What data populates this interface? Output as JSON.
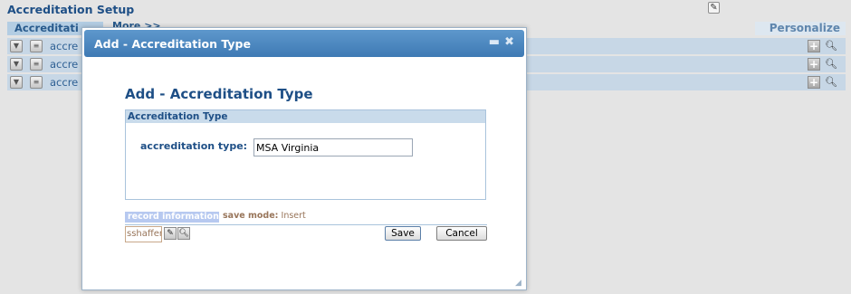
{
  "page": {
    "title": "Accreditation Setup"
  },
  "grid": {
    "tab_label": "Accreditati",
    "more_label": "More >>",
    "personalize_label": "Personalize",
    "rows": [
      {
        "text": "accre"
      },
      {
        "text": "accre"
      },
      {
        "text": "accre"
      }
    ]
  },
  "dialog": {
    "title": "Add - Accreditation Type",
    "min_glyph": "▬",
    "close_glyph": "✖",
    "heading": "Add - Accreditation Type",
    "panel_header": "Accreditation Type",
    "field_label": "accreditation type:",
    "field_value": "MSA Virginia",
    "record_info": "record information",
    "save_mode_label": "save mode:",
    "save_mode_value": "Insert",
    "user": "sshaffer",
    "save_button": "Save",
    "cancel_button": "Cancel"
  },
  "icons": {
    "edit": "edit-icon",
    "expand": "chevron-down-icon",
    "document": "document-icon",
    "add": "plus-icon",
    "search": "magnifier-icon",
    "pencil": "pencil-icon",
    "minimize": "minimize-icon",
    "close": "close-icon"
  },
  "colors": {
    "title_blue": "#1e4f86",
    "titlebar": "#4a87c0",
    "row_bg": "#c7d7e6",
    "save_mode": "#98755a"
  }
}
